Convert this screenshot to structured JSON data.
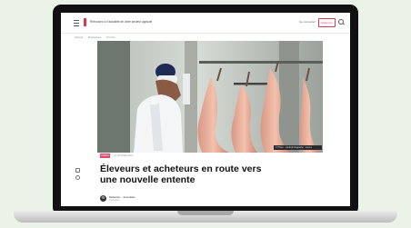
{
  "header": {
    "site_title": "Retrouvez ici l'actualité de votre secteur agricole",
    "login_label": "Se connecter",
    "subscribe_label": "S'abonner"
  },
  "breadcrumb": [
    "Accueil",
    "Productions",
    "Porcins"
  ],
  "hero": {
    "caption": "© Photo - crédit photographe · source"
  },
  "article": {
    "tag": "PORCS",
    "date": "12 JANVIER 2024",
    "headline": "Éleveurs et acheteurs en route vers une nouvelle entente",
    "author_name": "Rédaction · Journaliste",
    "author_role": "Journaliste"
  },
  "colors": {
    "accent": "#d83b52",
    "tag": "#e04a6a",
    "background": "#ebf2e7"
  }
}
